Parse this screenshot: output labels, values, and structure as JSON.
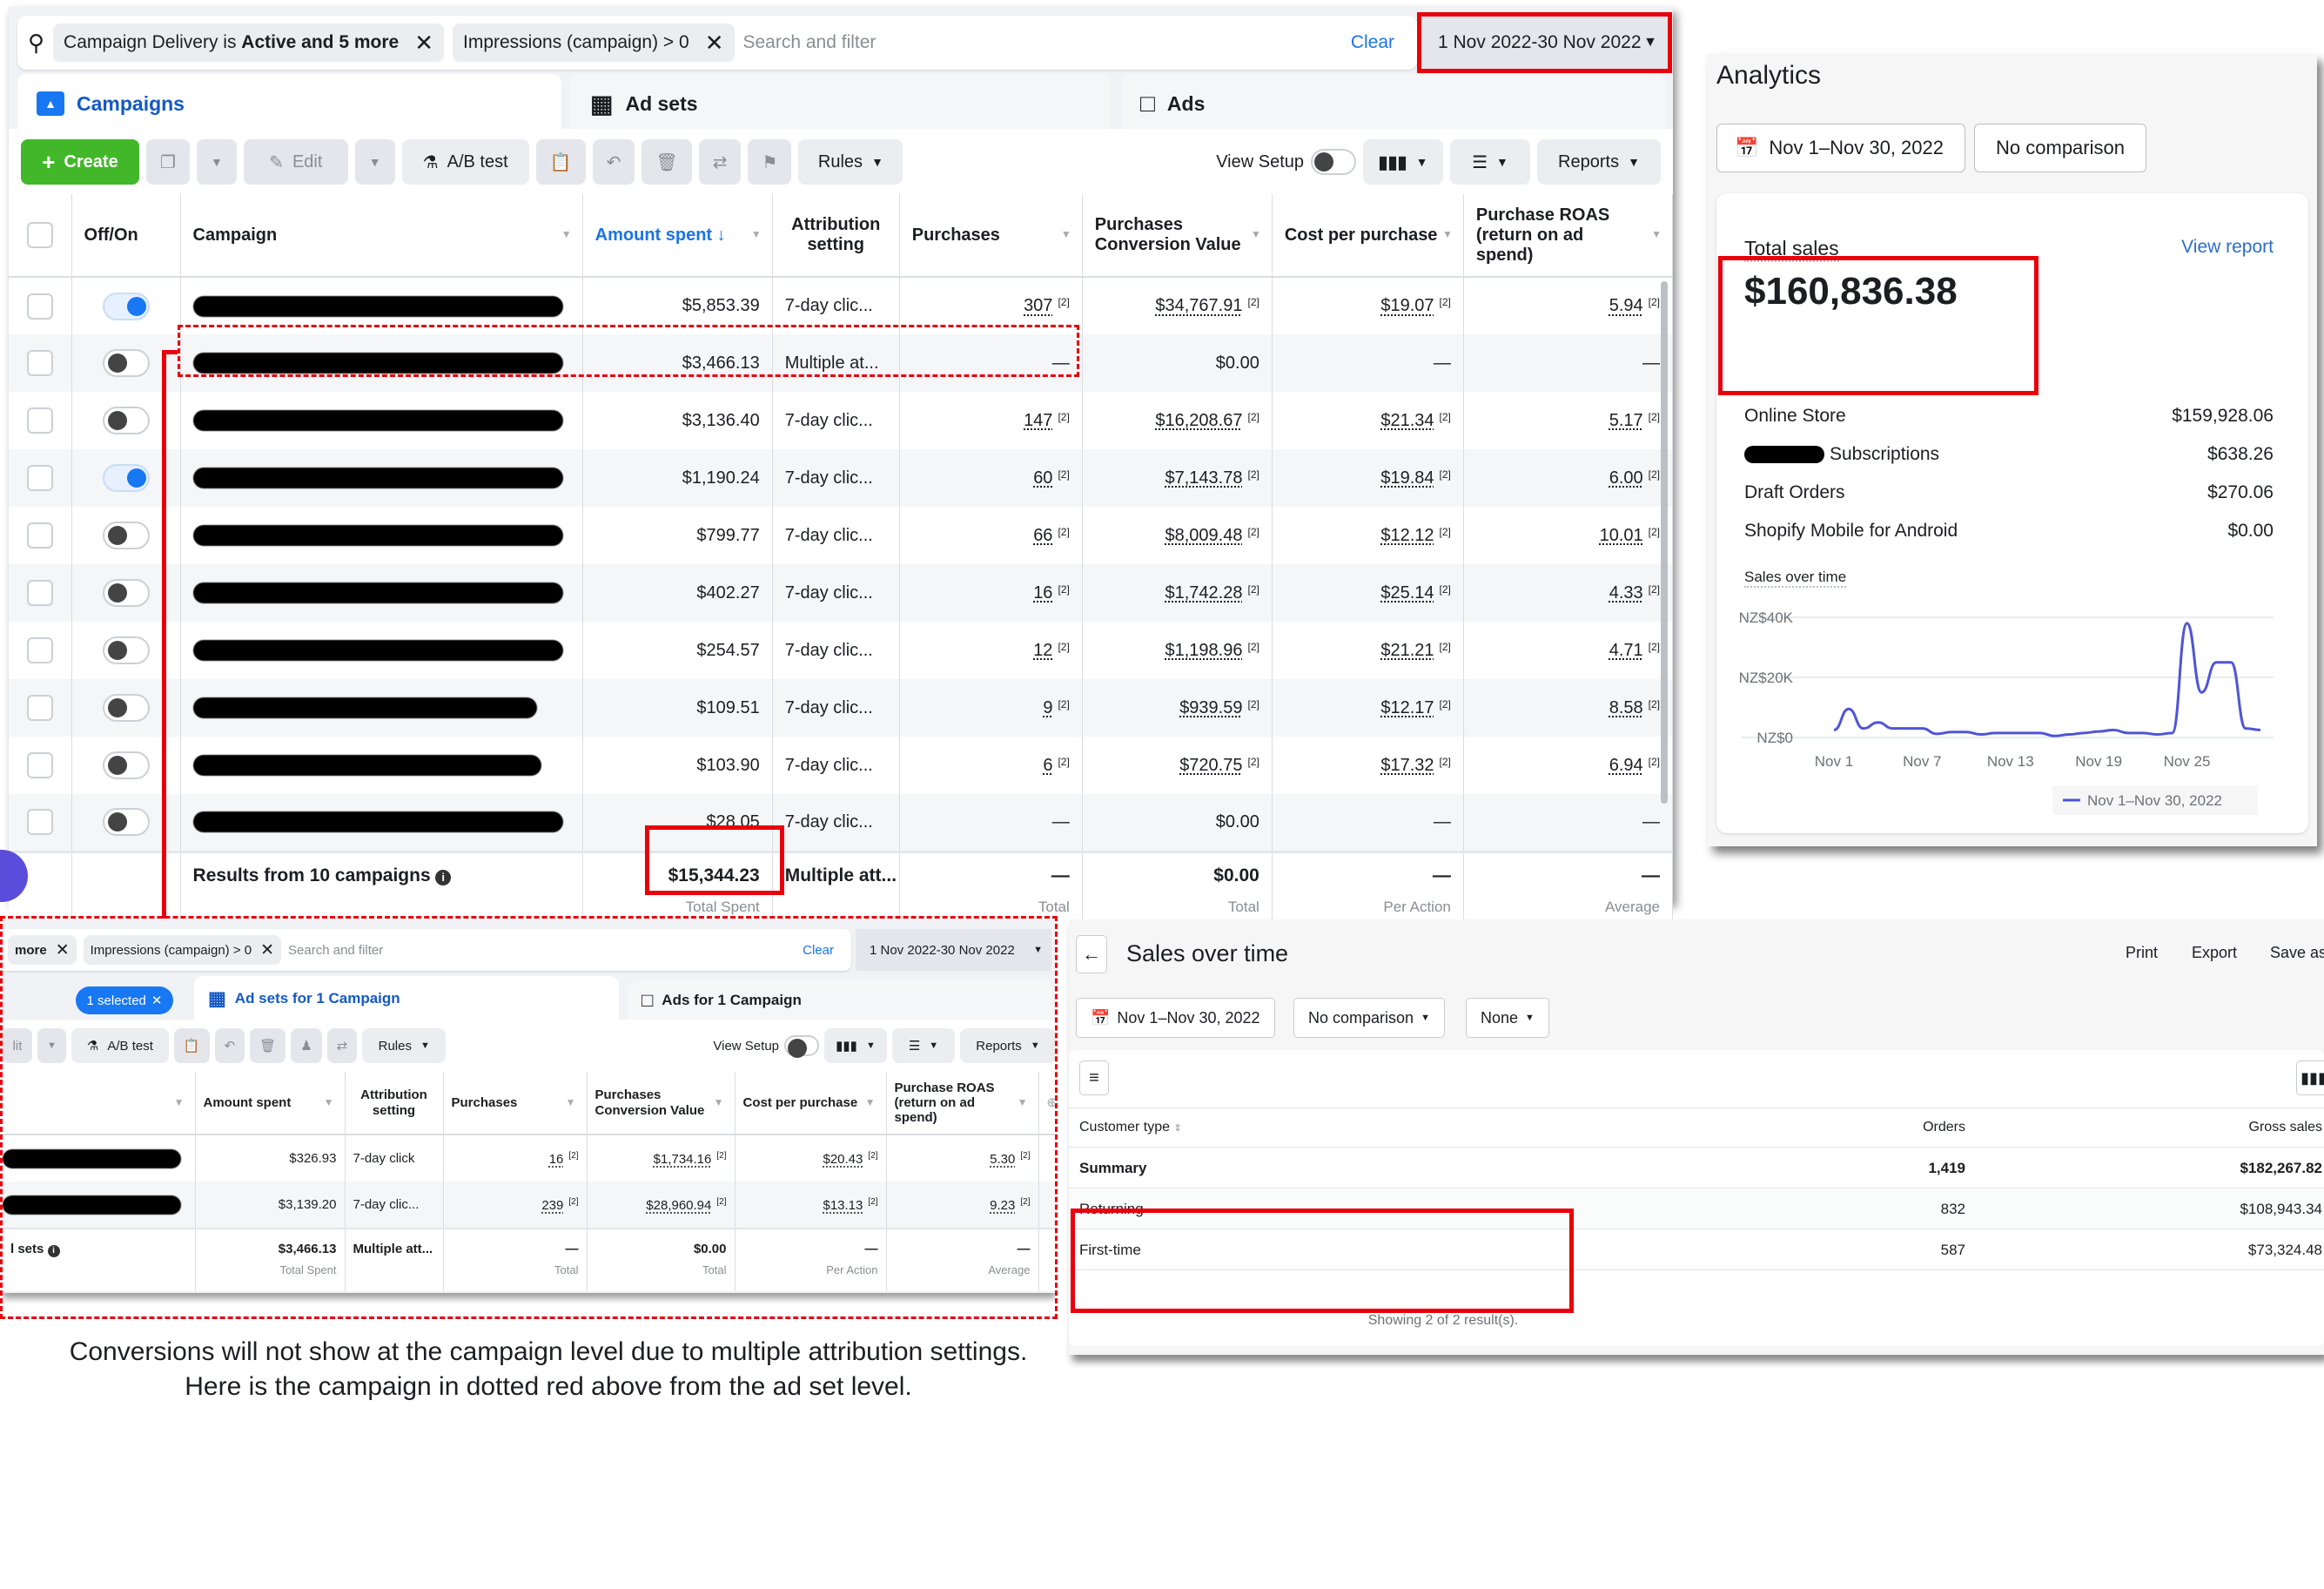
{
  "fb_campaigns": {
    "filters": [
      {
        "text_plain": "Campaign Delivery is ",
        "text_bold": "Active and 5 more"
      },
      {
        "text_plain": "Impressions (campaign) > 0",
        "text_bold": ""
      }
    ],
    "search_placeholder": "Search and filter",
    "clear_label": "Clear",
    "date_range": "1 Nov 2022-30 Nov 2022",
    "tabs": [
      {
        "label": "Campaigns",
        "active": true
      },
      {
        "label": "Ad sets",
        "active": false
      },
      {
        "label": "Ads",
        "active": false
      }
    ],
    "toolbar": {
      "create": "Create",
      "edit": "Edit",
      "ab_test": "A/B test",
      "rules": "Rules",
      "view_setup": "View Setup",
      "reports": "Reports"
    },
    "columns": [
      "Off/On",
      "Campaign",
      "Amount spent ↓",
      "Attribution setting",
      "Purchases",
      "Purchases Conversion Value",
      "Cost per purchase",
      "Purchase ROAS (return on ad spend)"
    ],
    "footnote_marker": "[2]",
    "rows": [
      {
        "on": true,
        "spent": "$5,853.39",
        "attribution": "7-day clic...",
        "purchases": "307",
        "conv_value": "$34,767.91",
        "cpp": "$19.07",
        "roas": "5.94",
        "highlighted": false
      },
      {
        "on": false,
        "spent": "$3,466.13",
        "attribution": "Multiple at...",
        "purchases": "—",
        "conv_value": "$0.00",
        "cpp": "—",
        "roas": "—",
        "highlighted": true
      },
      {
        "on": false,
        "spent": "$3,136.40",
        "attribution": "7-day clic...",
        "purchases": "147",
        "conv_value": "$16,208.67",
        "cpp": "$21.34",
        "roas": "5.17",
        "highlighted": false
      },
      {
        "on": true,
        "spent": "$1,190.24",
        "attribution": "7-day clic...",
        "purchases": "60",
        "conv_value": "$7,143.78",
        "cpp": "$19.84",
        "roas": "6.00",
        "highlighted": false
      },
      {
        "on": false,
        "spent": "$799.77",
        "attribution": "7-day clic...",
        "purchases": "66",
        "conv_value": "$8,009.48",
        "cpp": "$12.12",
        "roas": "10.01",
        "highlighted": false
      },
      {
        "on": false,
        "spent": "$402.27",
        "attribution": "7-day clic...",
        "purchases": "16",
        "conv_value": "$1,742.28",
        "cpp": "$25.14",
        "roas": "4.33",
        "highlighted": false
      },
      {
        "on": false,
        "spent": "$254.57",
        "attribution": "7-day clic...",
        "purchases": "12",
        "conv_value": "$1,198.96",
        "cpp": "$21.21",
        "roas": "4.71",
        "highlighted": false
      },
      {
        "on": false,
        "spent": "$109.51",
        "attribution": "7-day clic...",
        "purchases": "9",
        "conv_value": "$939.59",
        "cpp": "$12.17",
        "roas": "8.58",
        "highlighted": false
      },
      {
        "on": false,
        "spent": "$103.90",
        "attribution": "7-day clic...",
        "purchases": "6",
        "conv_value": "$720.75",
        "cpp": "$17.32",
        "roas": "6.94",
        "highlighted": false
      },
      {
        "on": false,
        "spent": "$28.05",
        "attribution": "7-day clic...",
        "purchases": "—",
        "conv_value": "$0.00",
        "cpp": "—",
        "roas": "—",
        "highlighted": false
      }
    ],
    "footer": {
      "label": "Results from 10 campaigns",
      "spent": "$15,344.23",
      "spent_sub": "Total Spent",
      "attribution": "Multiple att...",
      "purchases": "—",
      "purchases_sub": "Total",
      "conv_value": "$0.00",
      "conv_value_sub": "Total",
      "cpp": "—",
      "cpp_sub": "Per Action",
      "roas": "—",
      "roas_sub": "Average"
    }
  },
  "analytics": {
    "title": "Analytics",
    "date_button": "Nov 1–Nov 30, 2022",
    "comparison_button": "No comparison",
    "total_sales_label": "Total sales",
    "view_report": "View report",
    "total_sales_value": "$160,836.38",
    "channels": [
      {
        "name": "Online Store",
        "value": "$159,928.06",
        "redacted_prefix": false
      },
      {
        "name": "Subscriptions",
        "value": "$638.26",
        "redacted_prefix": true
      },
      {
        "name": "Draft Orders",
        "value": "$270.06",
        "redacted_prefix": false
      },
      {
        "name": "Shopify Mobile for Android",
        "value": "$0.00",
        "redacted_prefix": false
      }
    ],
    "chart_title": "Sales over time",
    "legend_label": "Nov 1–Nov 30, 2022",
    "line_color": "#4f55d6"
  },
  "chart_data": {
    "type": "line",
    "title": "Sales over time",
    "xlabel": "",
    "ylabel": "",
    "x": [
      "Nov 1",
      "Nov 2",
      "Nov 3",
      "Nov 4",
      "Nov 5",
      "Nov 6",
      "Nov 7",
      "Nov 8",
      "Nov 9",
      "Nov 10",
      "Nov 11",
      "Nov 12",
      "Nov 13",
      "Nov 14",
      "Nov 15",
      "Nov 16",
      "Nov 17",
      "Nov 18",
      "Nov 19",
      "Nov 20",
      "Nov 21",
      "Nov 22",
      "Nov 23",
      "Nov 24",
      "Nov 25",
      "Nov 26",
      "Nov 27",
      "Nov 28",
      "Nov 29",
      "Nov 30"
    ],
    "x_tick_labels": [
      "Nov 1",
      "Nov 7",
      "Nov 13",
      "Nov 19",
      "Nov 25"
    ],
    "y_tick_labels": [
      "NZ$0",
      "NZ$20K",
      "NZ$40K"
    ],
    "ylim": [
      0,
      40000
    ],
    "grid": true,
    "legend_position": "bottom-right",
    "series": [
      {
        "name": "Nov 1–Nov 30, 2022",
        "values": [
          2500,
          9500,
          3000,
          5000,
          3000,
          3000,
          3000,
          1200,
          1800,
          1800,
          1000,
          1500,
          1500,
          1500,
          1500,
          500,
          1000,
          1500,
          2000,
          2500,
          1500,
          1500,
          1000,
          1500,
          38000,
          15000,
          25000,
          25000,
          3000,
          2500
        ]
      }
    ]
  },
  "adset_panel": {
    "filters": [
      {
        "text_plain": "more",
        "text_bold": ""
      },
      {
        "text_plain": "Impressions (campaign) > 0",
        "text_bold": ""
      }
    ],
    "search_placeholder": "Search and filter",
    "clear_label": "Clear",
    "date_range": "1 Nov 2022-30 Nov 2022",
    "selected_chip": "1 selected",
    "tabs": [
      {
        "label": "Ad sets for 1 Campaign",
        "active": true
      },
      {
        "label": "Ads for 1 Campaign",
        "active": false
      }
    ],
    "toolbar": {
      "edit_partial": "lit",
      "ab_test": "A/B test",
      "rules": "Rules",
      "view_setup": "View Setup",
      "reports": "Reports"
    },
    "columns": [
      "",
      "Amount spent",
      "Attribution setting",
      "Purchases",
      "Purchases Conversion Value",
      "Cost per purchase",
      "Purchase ROAS (return on ad spend)"
    ],
    "rows": [
      {
        "spent": "$326.93",
        "attribution": "7-day click",
        "purchases": "16",
        "conv_value": "$1,734.16",
        "cpp": "$20.43",
        "roas": "5.30"
      },
      {
        "spent": "$3,139.20",
        "attribution": "7-day clic...",
        "purchases": "239",
        "conv_value": "$28,960.94",
        "cpp": "$13.13",
        "roas": "9.23"
      }
    ],
    "footer": {
      "label": "l sets",
      "spent": "$3,466.13",
      "spent_sub": "Total Spent",
      "attribution": "Multiple att...",
      "purchases": "—",
      "purchases_sub": "Total",
      "conv_value": "$0.00",
      "conv_value_sub": "Total",
      "cpp": "—",
      "cpp_sub": "Per Action",
      "roas": "—",
      "roas_sub": "Average"
    }
  },
  "caption": {
    "line1": "Conversions will not show at the campaign level due to multiple attribution settings.",
    "line2": "Here is the campaign in dotted red above from the ad set level."
  },
  "sales_report": {
    "title": "Sales over time",
    "actions": [
      "Print",
      "Export",
      "Save as"
    ],
    "date_button": "Nov 1–Nov 30, 2022",
    "comparison_button": "No comparison",
    "none_button": "None",
    "columns": [
      "Customer type",
      "Orders",
      "Gross sales"
    ],
    "summary": {
      "label": "Summary",
      "orders": "1,419",
      "gross": "$182,267.82"
    },
    "rows": [
      {
        "label": "Returning",
        "orders": "832",
        "gross": "$108,943.34"
      },
      {
        "label": "First-time",
        "orders": "587",
        "gross": "$73,324.48"
      }
    ],
    "footer_text": "Showing 2 of 2 result(s)."
  },
  "colors": {
    "highlight_red": "#e8000b",
    "fb_blue": "#1877f2",
    "create_green": "#42b72a",
    "link_blue": "#2c6ecb"
  }
}
